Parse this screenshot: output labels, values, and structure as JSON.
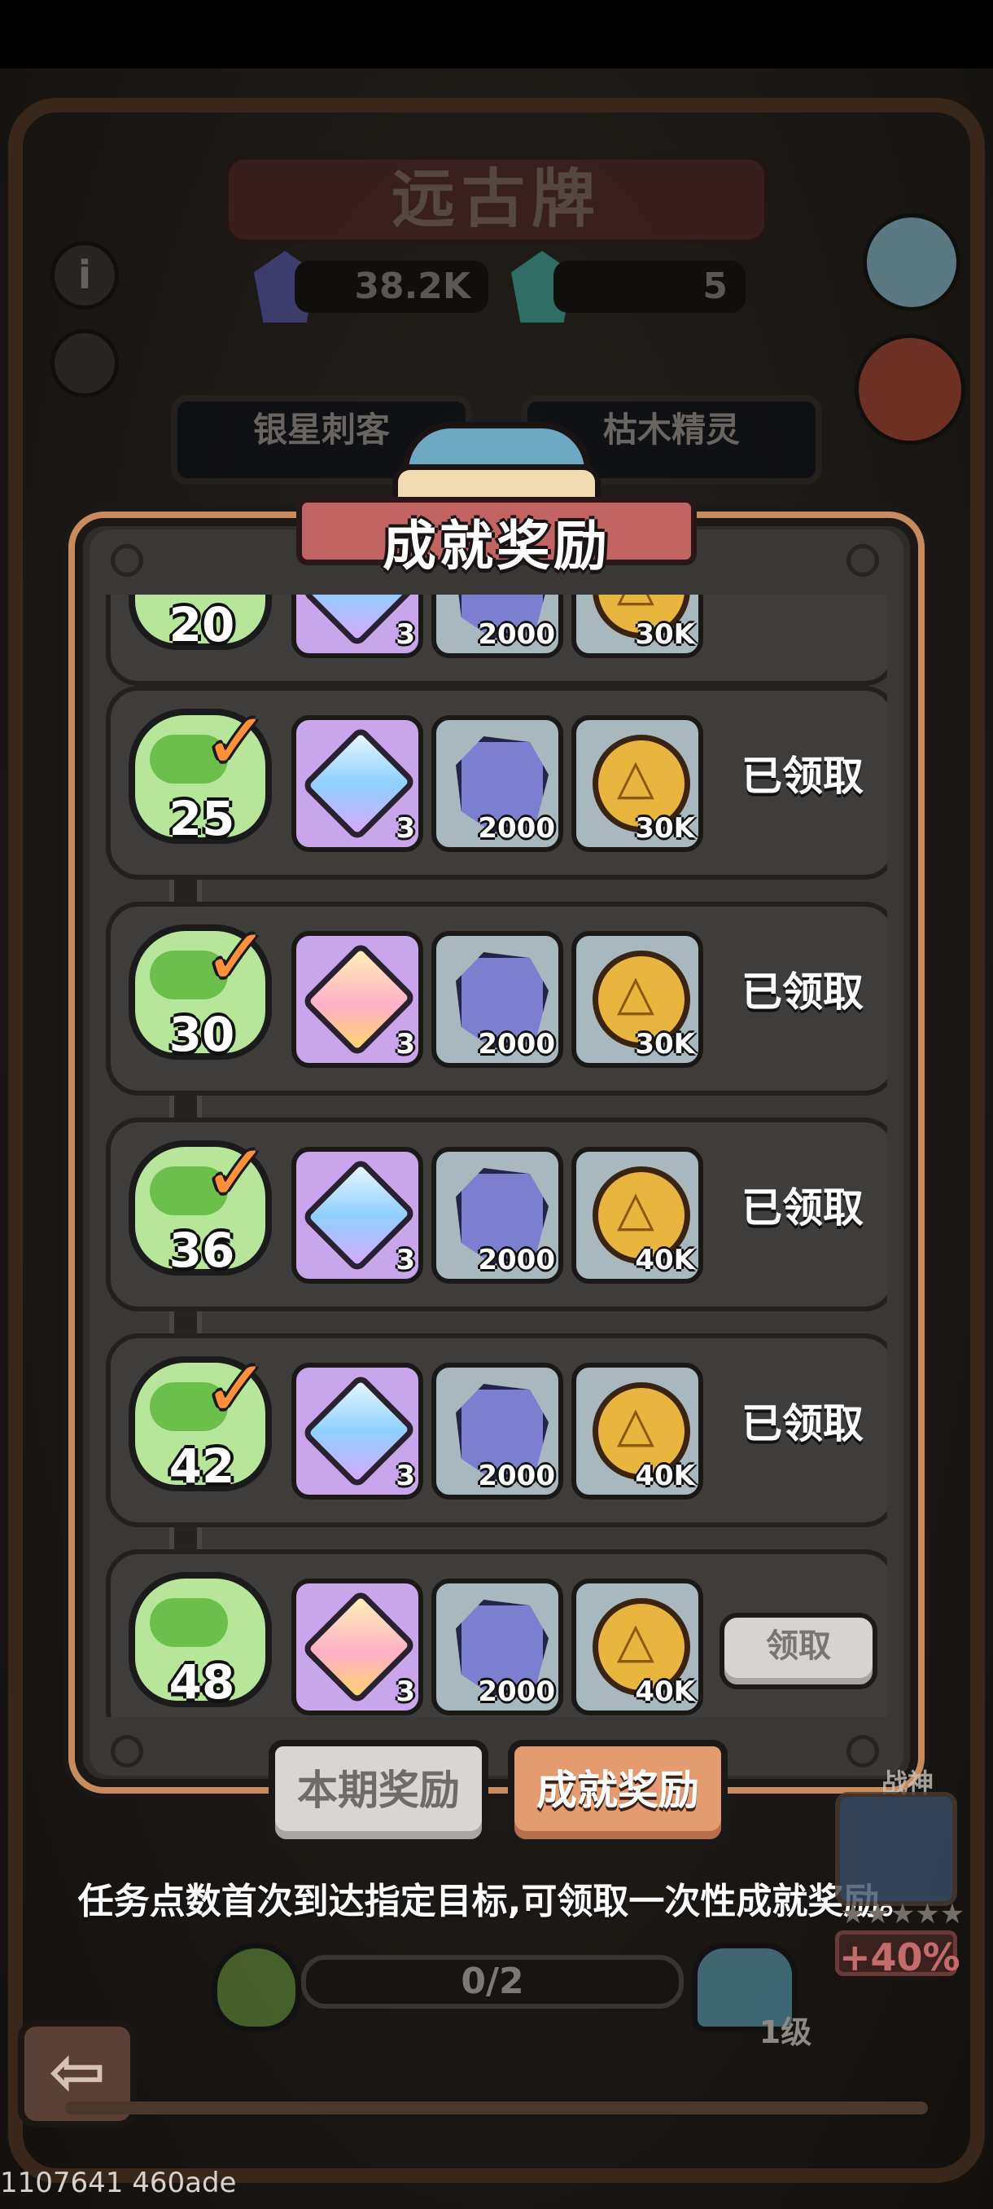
{
  "background": {
    "title": "远古牌",
    "resource_1_value": "38.2K",
    "resource_2_value": "5",
    "card_tab_1": "银星刺客",
    "card_tab_2": "枯木精灵",
    "info_icon": "i",
    "back_icon": "⇦"
  },
  "modal": {
    "title": "成就奖励",
    "rows": [
      {
        "level": "20",
        "claimed": true,
        "status": "",
        "rewards": [
          {
            "type": "gem-purple",
            "qty": "3"
          },
          {
            "type": "stone",
            "qty": "2000"
          },
          {
            "type": "coin",
            "qty": "30K"
          }
        ]
      },
      {
        "level": "25",
        "claimed": true,
        "status": "已领取",
        "rewards": [
          {
            "type": "gem-blue",
            "qty": "3"
          },
          {
            "type": "stone",
            "qty": "2000"
          },
          {
            "type": "coin",
            "qty": "30K"
          }
        ]
      },
      {
        "level": "30",
        "claimed": true,
        "status": "已领取",
        "rewards": [
          {
            "type": "gem-pink",
            "qty": "3"
          },
          {
            "type": "stone",
            "qty": "2000"
          },
          {
            "type": "coin",
            "qty": "30K"
          }
        ]
      },
      {
        "level": "36",
        "claimed": true,
        "status": "已领取",
        "rewards": [
          {
            "type": "gem-blue",
            "qty": "3"
          },
          {
            "type": "stone",
            "qty": "2000"
          },
          {
            "type": "coin",
            "qty": "40K"
          }
        ]
      },
      {
        "level": "42",
        "claimed": true,
        "status": "已领取",
        "rewards": [
          {
            "type": "gem-blue",
            "qty": "3"
          },
          {
            "type": "stone",
            "qty": "2000"
          },
          {
            "type": "coin",
            "qty": "40K"
          }
        ]
      },
      {
        "level": "48",
        "claimed": false,
        "status": "",
        "claim_label": "领取",
        "rewards": [
          {
            "type": "gem-pink",
            "qty": "3"
          },
          {
            "type": "stone",
            "qty": "2000"
          },
          {
            "type": "coin",
            "qty": "40K"
          }
        ]
      }
    ],
    "tabs": {
      "period_rewards": "本期奖励",
      "achievement_rewards": "成就奖励"
    }
  },
  "hint_text": "任务点数首次到达指定目标,可领取一次性成就奖励。",
  "progress": {
    "text": "0/2",
    "level_label": "1级"
  },
  "boost": {
    "name": "战神",
    "stars": "★★★★★",
    "percent": "+40%"
  },
  "watermark": "1107641 460ade"
}
